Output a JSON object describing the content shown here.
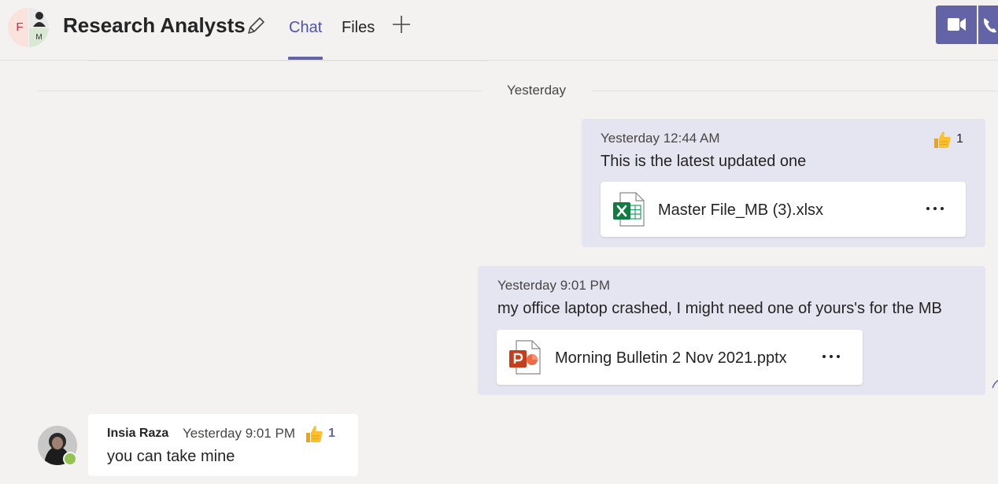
{
  "header": {
    "group_avatar_initials": [
      "F",
      "M"
    ],
    "title": "Research Analysts",
    "tabs": [
      {
        "label": "Chat",
        "active": true
      },
      {
        "label": "Files",
        "active": false
      }
    ]
  },
  "date_separator": "Yesterday",
  "messages": [
    {
      "own": true,
      "timestamp": "Yesterday 12:44 AM",
      "text": "This is the latest updated one",
      "reaction": {
        "icon": "thumbs-up-icon",
        "count": "1"
      },
      "attachment": {
        "type": "xlsx-icon",
        "name": "Master File_MB (3).xlsx",
        "more": "•••"
      }
    },
    {
      "own": true,
      "timestamp": "Yesterday 9:01 PM",
      "text": "my office laptop crashed, I might need one of yours's for the MB",
      "attachment": {
        "type": "pptx-icon",
        "name": "Morning Bulletin 2 Nov 2021.pptx",
        "more": "•••"
      }
    },
    {
      "own": false,
      "sender": "Insia Raza",
      "timestamp": "Yesterday 9:01 PM",
      "text": "you can take mine",
      "reaction": {
        "icon": "thumbs-up-icon",
        "count": "1"
      },
      "presence": "available"
    }
  ],
  "colors": {
    "accent": "#6264a7",
    "own_bubble": "#e5e5f1",
    "background": "#f3f2f1",
    "presence_available": "#92c353"
  }
}
